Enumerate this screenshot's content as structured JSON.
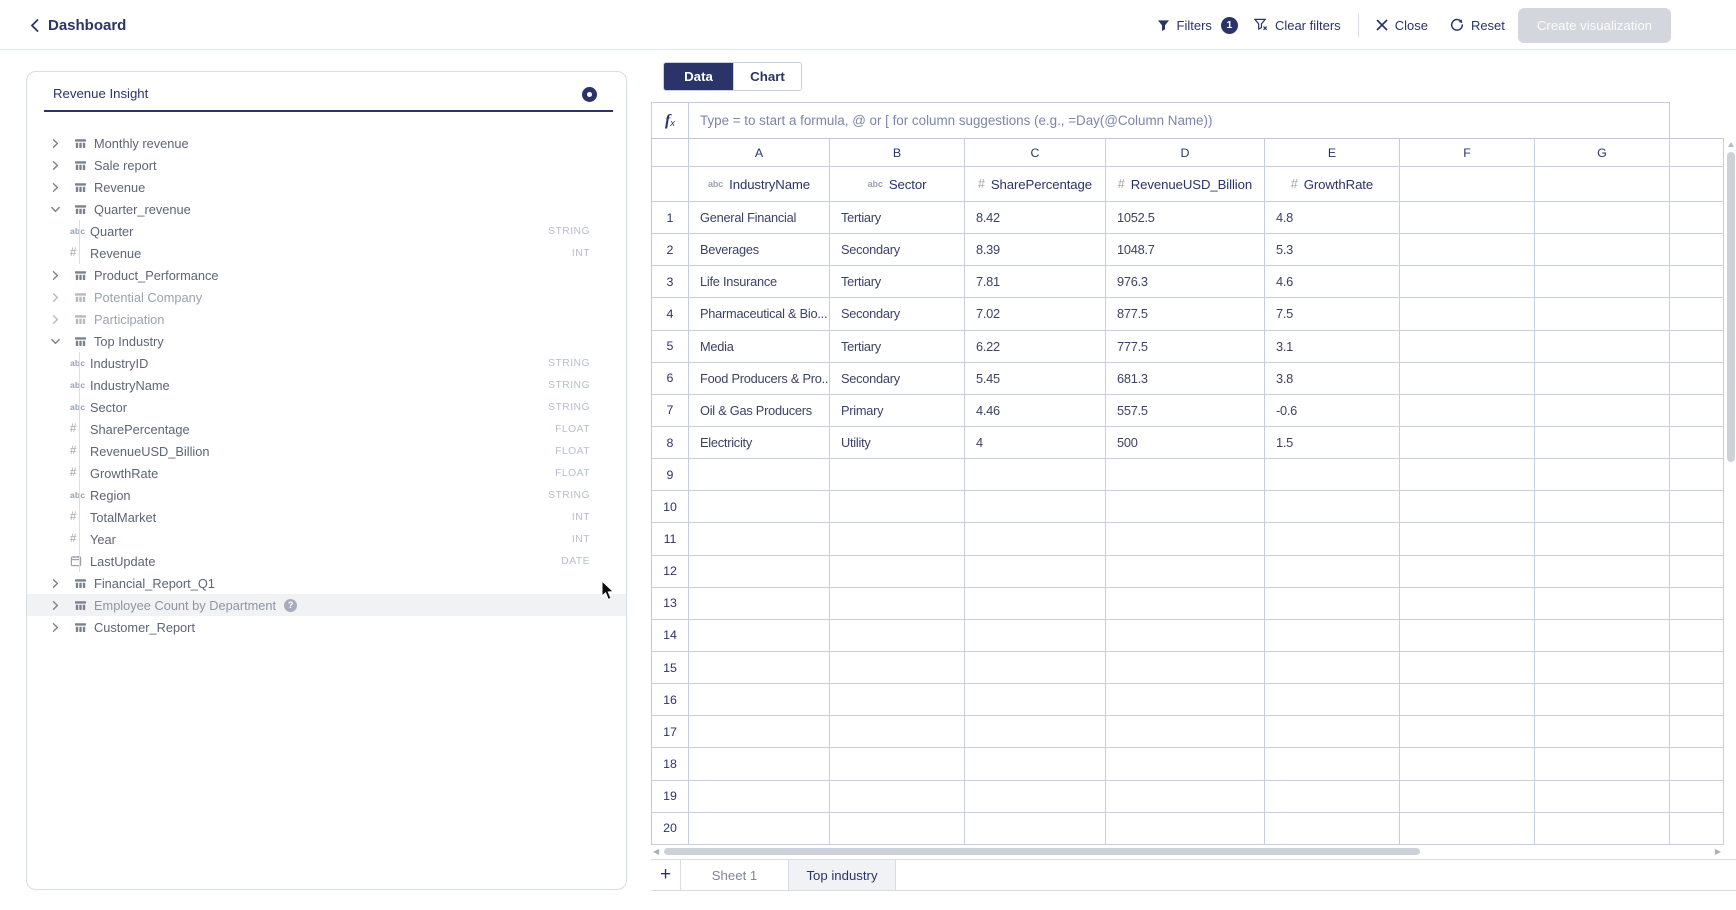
{
  "header": {
    "back_label": "Dashboard",
    "filters_label": "Filters",
    "filters_badge": "1",
    "clear_filters_label": "Clear filters",
    "close_label": "Close",
    "reset_label": "Reset",
    "create_viz_label": "Create visualization"
  },
  "sidebar": {
    "search_value": "Revenue Insight",
    "tree": [
      {
        "label": "Monthly revenue",
        "kind": "table"
      },
      {
        "label": "Sale report",
        "kind": "table"
      },
      {
        "label": "Revenue",
        "kind": "table"
      },
      {
        "label": "Quarter_revenue",
        "kind": "table",
        "expanded": true
      },
      {
        "label": "Quarter",
        "kind": "field",
        "icon": "abc",
        "dtype": "STRING"
      },
      {
        "label": "Revenue",
        "kind": "field",
        "icon": "num",
        "dtype": "INT"
      },
      {
        "label": "Product_Performance",
        "kind": "table"
      },
      {
        "label": "Potential Company",
        "kind": "table",
        "dimmed": true
      },
      {
        "label": "Participation",
        "kind": "table",
        "dimmed": true
      },
      {
        "label": "Top Industry",
        "kind": "table",
        "expanded": true
      },
      {
        "label": "IndustryID",
        "kind": "field",
        "icon": "abc",
        "dtype": "STRING"
      },
      {
        "label": "IndustryName",
        "kind": "field",
        "icon": "abc",
        "dtype": "STRING"
      },
      {
        "label": "Sector",
        "kind": "field",
        "icon": "abc",
        "dtype": "STRING"
      },
      {
        "label": "SharePercentage",
        "kind": "field",
        "icon": "num",
        "dtype": "FLOAT"
      },
      {
        "label": "RevenueUSD_Billion",
        "kind": "field",
        "icon": "num",
        "dtype": "FLOAT"
      },
      {
        "label": "GrowthRate",
        "kind": "field",
        "icon": "num",
        "dtype": "FLOAT"
      },
      {
        "label": "Region",
        "kind": "field",
        "icon": "abc",
        "dtype": "STRING"
      },
      {
        "label": "TotalMarket",
        "kind": "field",
        "icon": "num",
        "dtype": "INT"
      },
      {
        "label": "Year",
        "kind": "field",
        "icon": "num",
        "dtype": "INT"
      },
      {
        "label": "LastUpdate",
        "kind": "field",
        "icon": "date",
        "dtype": "DATE"
      },
      {
        "label": "Financial_Report_Q1",
        "kind": "table"
      },
      {
        "label": "Employee Count by Department",
        "kind": "table",
        "highlighted": true,
        "help_badge": true
      },
      {
        "label": "Customer_Report",
        "kind": "table"
      }
    ]
  },
  "main": {
    "tabs": [
      {
        "label": "Data",
        "active": true
      },
      {
        "label": "Chart",
        "active": false
      }
    ],
    "formula_placeholder": "Type = to start a formula, @ or [ for column suggestions (e.g., =Day(@Column Name))",
    "grid": {
      "column_letters": [
        "A",
        "B",
        "C",
        "D",
        "E",
        "F",
        "G"
      ],
      "fields": [
        {
          "column": "A",
          "icon": "abc",
          "name": "IndustryName"
        },
        {
          "column": "B",
          "icon": "abc",
          "name": "Sector"
        },
        {
          "column": "C",
          "icon": "num",
          "name": "SharePercentage"
        },
        {
          "column": "D",
          "icon": "num",
          "name": "RevenueUSD_Billion"
        },
        {
          "column": "E",
          "icon": "num",
          "name": "GrowthRate"
        }
      ],
      "rows": [
        [
          "General Financial",
          "Tertiary",
          "8.42",
          "1052.5",
          "4.8"
        ],
        [
          "Beverages",
          "Secondary",
          "8.39",
          "1048.7",
          "5.3"
        ],
        [
          "Life Insurance",
          "Tertiary",
          "7.81",
          "976.3",
          "4.6"
        ],
        [
          "Pharmaceutical & Bio...",
          "Secondary",
          "7.02",
          "877.5",
          "7.5"
        ],
        [
          "Media",
          "Tertiary",
          "6.22",
          "777.5",
          "3.1"
        ],
        [
          "Food Producers & Pro...",
          "Secondary",
          "5.45",
          "681.3",
          "3.8"
        ],
        [
          "Oil & Gas Producers",
          "Primary",
          "4.46",
          "557.5",
          "-0.6"
        ],
        [
          "Electricity",
          "Utility",
          "4",
          "500",
          "1.5"
        ]
      ],
      "visible_row_count": 20
    },
    "sheet_bar": {
      "add_label": "+",
      "tabs": [
        {
          "label": "Sheet 1",
          "active": false
        },
        {
          "label": "Top industry",
          "active": true
        }
      ]
    }
  }
}
